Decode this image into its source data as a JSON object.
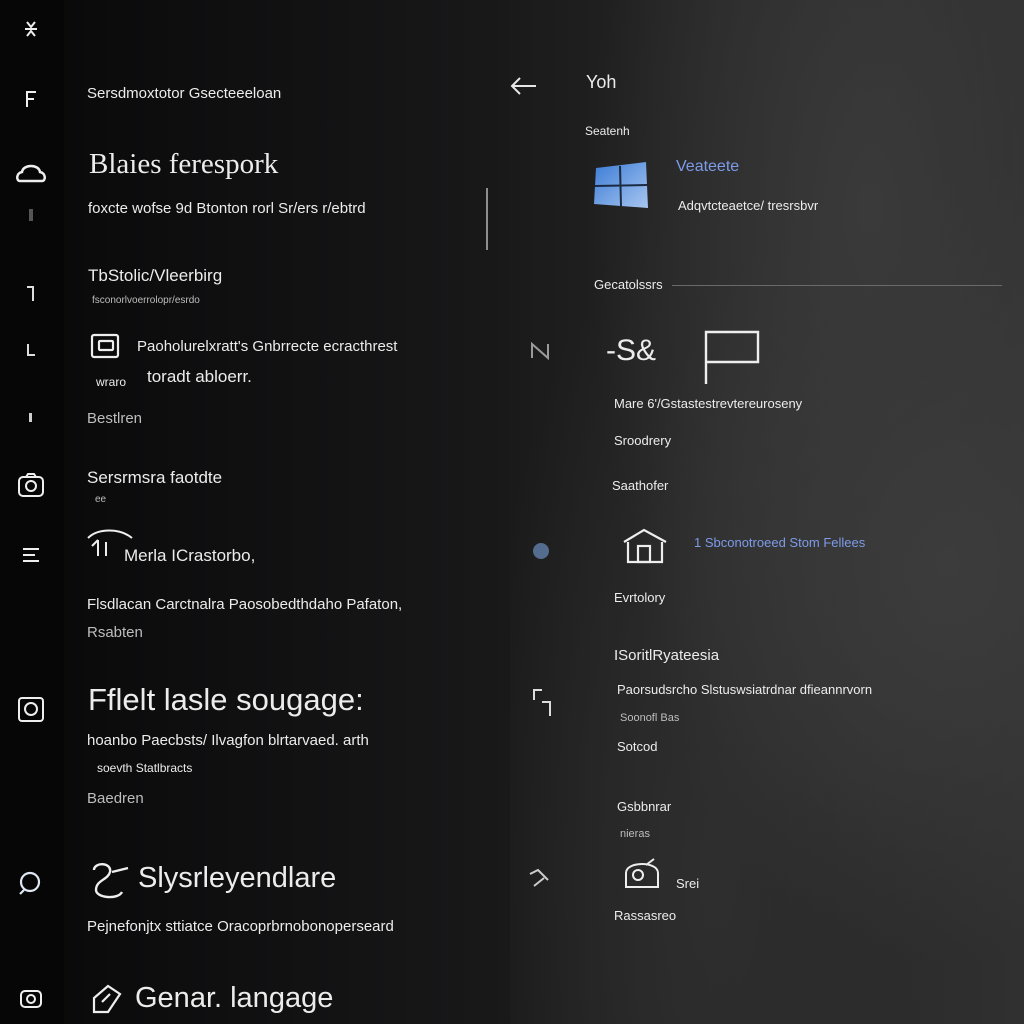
{
  "rail": {
    "icons": [
      "bug-icon",
      "f-icon",
      "cloud-icon",
      "dot-icon",
      "pin-icon",
      "l-icon",
      "dot-small-icon",
      "photo-icon",
      "list-icon",
      "camera-icon",
      "search-icon",
      "gallery-icon"
    ]
  },
  "left": {
    "header_small": "Sersdmoxtotor Gsecteeeloan",
    "title1": "Blaies ferespork",
    "line1": "foxcte wofse 9d Btonton rorl Sr/ers r/ebtrd",
    "section1_title": "TbStolic/Vleerbirg",
    "section1_sub": "fsconorlvoerrolopr/esrdo",
    "item1_line1": "Paoholurelxratt's Gnbrrecte ecracthrest",
    "item1_line2": "toradt abloerr.",
    "item1_tag": "wraro",
    "item1_footer": "Bestlren",
    "section2_title": "Sersrmsra faotdte",
    "section2_sub": "ee",
    "item2_title": "Merla ICrastorbo,",
    "item2_line": "Flsdlacan Carctnalra Paosobedthdaho Pafaton,",
    "item2_footer": "Rsabten",
    "title2": "Fflelt lasle sougage:",
    "item3_line1": "hoanbo Paecbsts/ Ilvagfon blrtarvaed. arth",
    "item3_line2": "soevth Statlbracts",
    "item3_footer": "Baedren",
    "title3": "Slysrleyendlare",
    "item4_line": "Pejnefonjtx sttiatce Oracoprbrnobonoperseard",
    "title4": "Genar. langage"
  },
  "right": {
    "back_label": "Yoh",
    "section_small": "Seatenh",
    "app_name": "Veateete",
    "app_desc": "Adqvtcteaetce/ tresrsbvr",
    "section2_label": "Gecatolssrs",
    "symbol": "-S&",
    "info_line": "Mare 6'/Gstastestrevtereuroseny",
    "label_a": "Sroodrery",
    "label_b": "Saathofer",
    "link_line": "1 Sbconotroeed Stom Fellees",
    "label_c": "Evrtolory",
    "section3_title": "ISoritlRyateesia",
    "section3_line": "Paorsudsrcho Slstuswsiatrdnar dfieannrvorn",
    "section3_sub": "Soonofl Bas",
    "section3_tag": "Sotcod",
    "label_d": "Gsbbnrar",
    "label_d_sub": "nieras",
    "item5_label": "Srei",
    "item5_footer": "Rassasreo"
  }
}
